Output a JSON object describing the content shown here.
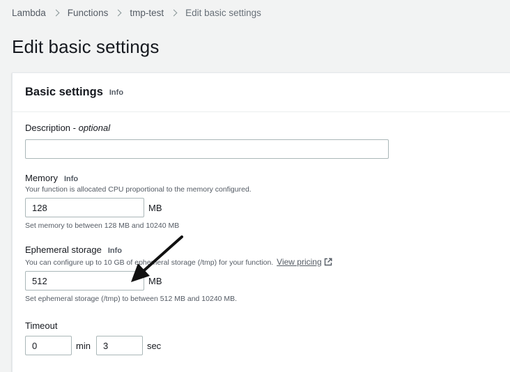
{
  "breadcrumb": {
    "items": [
      "Lambda",
      "Functions",
      "tmp-test"
    ],
    "current": "Edit basic settings"
  },
  "page_title": "Edit basic settings",
  "container": {
    "title": "Basic settings",
    "info": "Info"
  },
  "description_field": {
    "label": "Description",
    "label_suffix": " - ",
    "optional": "optional",
    "value": ""
  },
  "memory": {
    "label": "Memory",
    "info": "Info",
    "help": "Your function is allocated CPU proportional to the memory configured.",
    "value": "128",
    "unit": "MB",
    "constraint": "Set memory to between 128 MB and 10240 MB"
  },
  "ephemeral": {
    "label": "Ephemeral storage",
    "info": "Info",
    "help": "You can configure up to 10 GB of ephemeral storage (/tmp) for your function.",
    "link": "View pricing",
    "value": "512",
    "unit": "MB",
    "constraint": "Set ephemeral storage (/tmp) to between 512 MB and 10240 MB."
  },
  "timeout": {
    "label": "Timeout",
    "min_value": "0",
    "min_unit": "min",
    "sec_value": "3",
    "sec_unit": "sec"
  },
  "icons": [
    "chevron-right-icon",
    "external-link-icon",
    "annotation-arrow-icon"
  ]
}
